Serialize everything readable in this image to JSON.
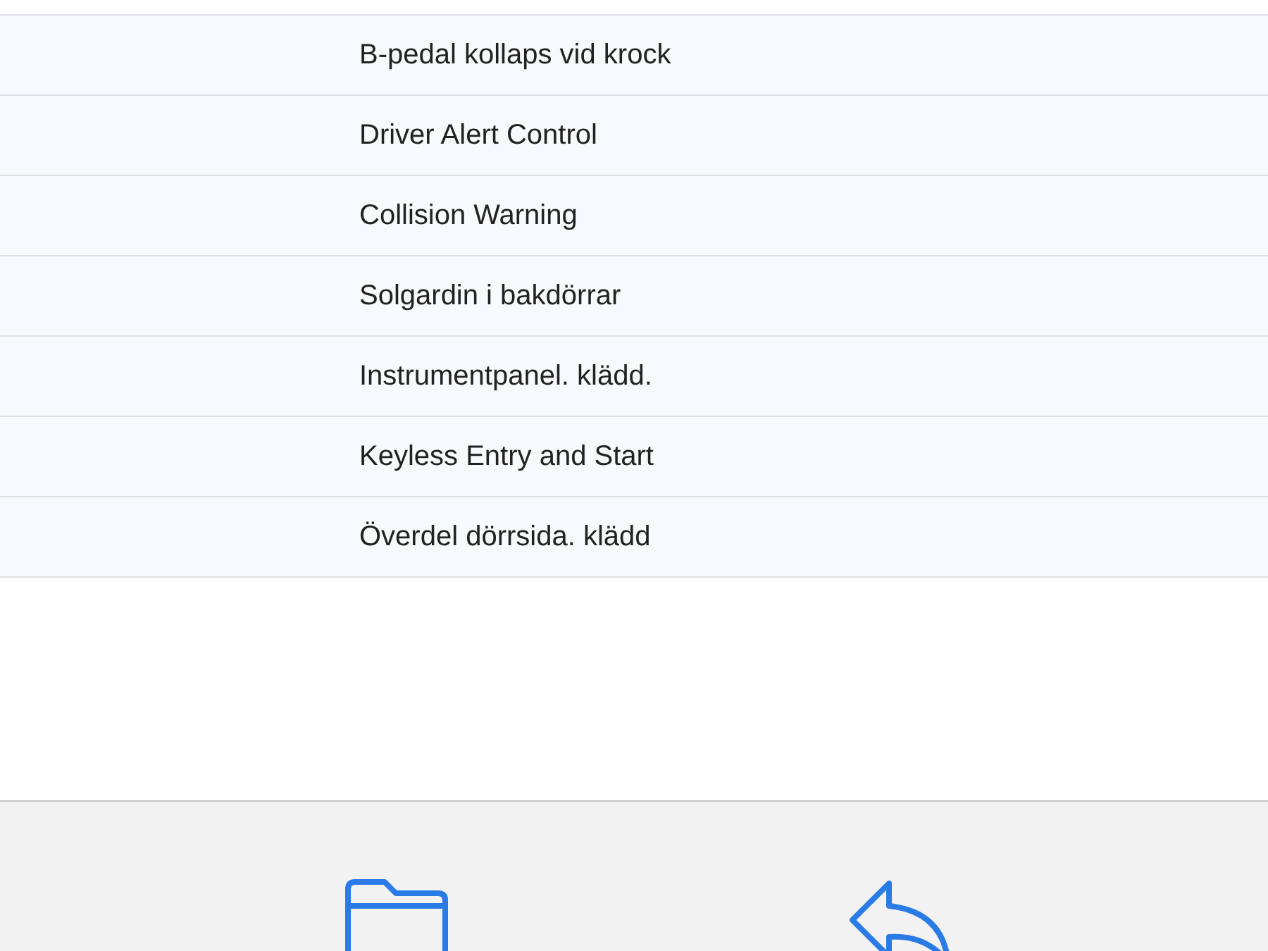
{
  "list": {
    "items": [
      {
        "label": "B-pedal kollaps vid krock"
      },
      {
        "label": "Driver Alert Control"
      },
      {
        "label": "Collision Warning"
      },
      {
        "label": "Solgardin i bakdörrar"
      },
      {
        "label": "Instrumentpanel. klädd."
      },
      {
        "label": "Keyless Entry and Start"
      },
      {
        "label": "Överdel dörrsida. klädd"
      }
    ]
  },
  "toolbar": {
    "buttons": [
      {
        "kind": "folder"
      },
      {
        "kind": "reply"
      }
    ]
  }
}
